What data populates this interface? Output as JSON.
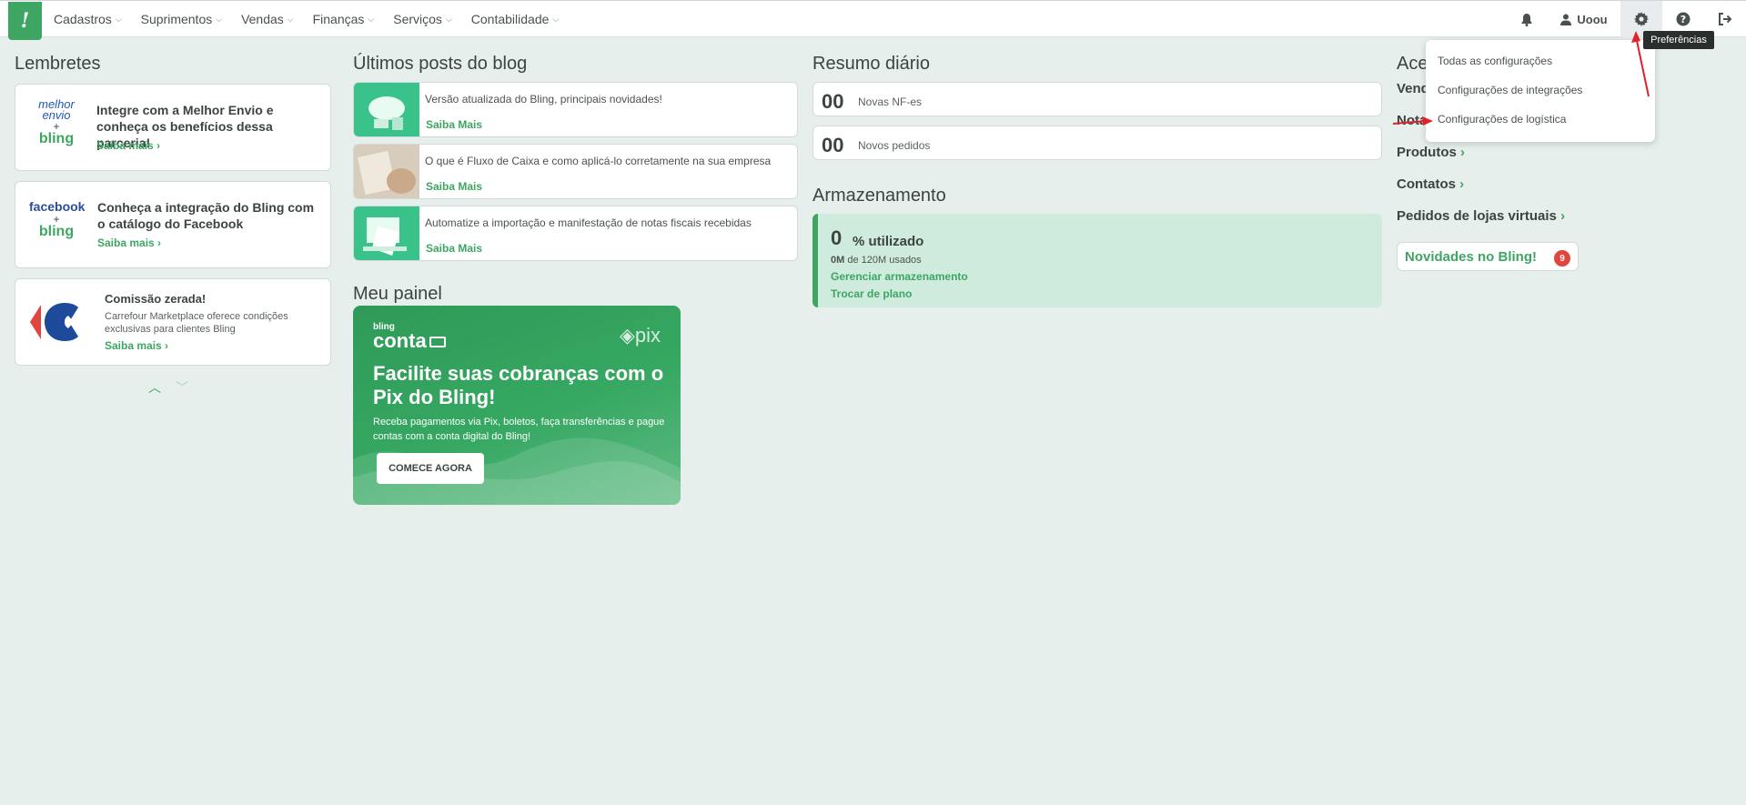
{
  "nav": {
    "items": [
      {
        "label": "Cadastros"
      },
      {
        "label": "Suprimentos"
      },
      {
        "label": "Vendas"
      },
      {
        "label": "Finanças"
      },
      {
        "label": "Serviços"
      },
      {
        "label": "Contabilidade"
      }
    ],
    "user": "Uoou",
    "tooltip": "Preferências"
  },
  "dropdown": {
    "items": [
      "Todas as configurações",
      "Configurações de integrações",
      "Configurações de logística"
    ]
  },
  "lembretes": {
    "title": "Lembretes",
    "cards": [
      {
        "logo_top": "melhor",
        "logo_mid": "envio",
        "logo_bottom": "bling",
        "title": "Integre com a Melhor Envio e conheça os benefícios dessa parceria!",
        "link": "Saiba mais"
      },
      {
        "logo_top": "facebook",
        "logo_bottom": "bling",
        "title": "Conheça a integração do Bling com o catálogo do Facebook",
        "link": "Saiba mais"
      },
      {
        "title": "Comissão zerada!",
        "text": "Carrefour Marketplace oferece condições exclusivas para clientes Bling",
        "link": "Saiba mais"
      }
    ]
  },
  "blog": {
    "title": "Últimos posts do blog",
    "posts": [
      {
        "title": "Versão atualizada do Bling, principais novidades!",
        "link": "Saiba Mais"
      },
      {
        "title": "O que é Fluxo de Caixa e como aplicá-lo corretamente na sua empresa",
        "link": "Saiba Mais"
      },
      {
        "title": "Automatize a importação e manifestação de notas fiscais recebidas",
        "link": "Saiba Mais"
      }
    ]
  },
  "painel": {
    "title": "Meu painel",
    "brand_small": "bling",
    "brand": "conta",
    "pix": "pix",
    "headline": "Facilite suas cobranças com o Pix do Bling!",
    "sub": "Receba pagamentos via Pix, boletos, faça transferências e pague contas com a conta digital do Bling!",
    "cta": "COMECE AGORA"
  },
  "resumo": {
    "title": "Resumo diário",
    "rows": [
      {
        "num": "00",
        "label": "Novas NF-es"
      },
      {
        "num": "00",
        "label": "Novos pedidos"
      }
    ]
  },
  "armazenamento": {
    "title": "Armazenamento",
    "percent": "0",
    "percent_label": "% utilizado",
    "used_bold": "0M",
    "used_rest": "de 120M usados",
    "link1": "Gerenciar armazenamento",
    "link2": "Trocar de plano"
  },
  "acesso": {
    "title": "Ace",
    "items": [
      "Vend",
      "Nota",
      "Produtos",
      "Contatos",
      "Pedidos de lojas virtuais"
    ],
    "news": "Novidades no Bling!",
    "news_count": "9"
  },
  "colors": {
    "accent": "#3ea662",
    "background": "#e6efec",
    "badge": "#e0453e"
  }
}
